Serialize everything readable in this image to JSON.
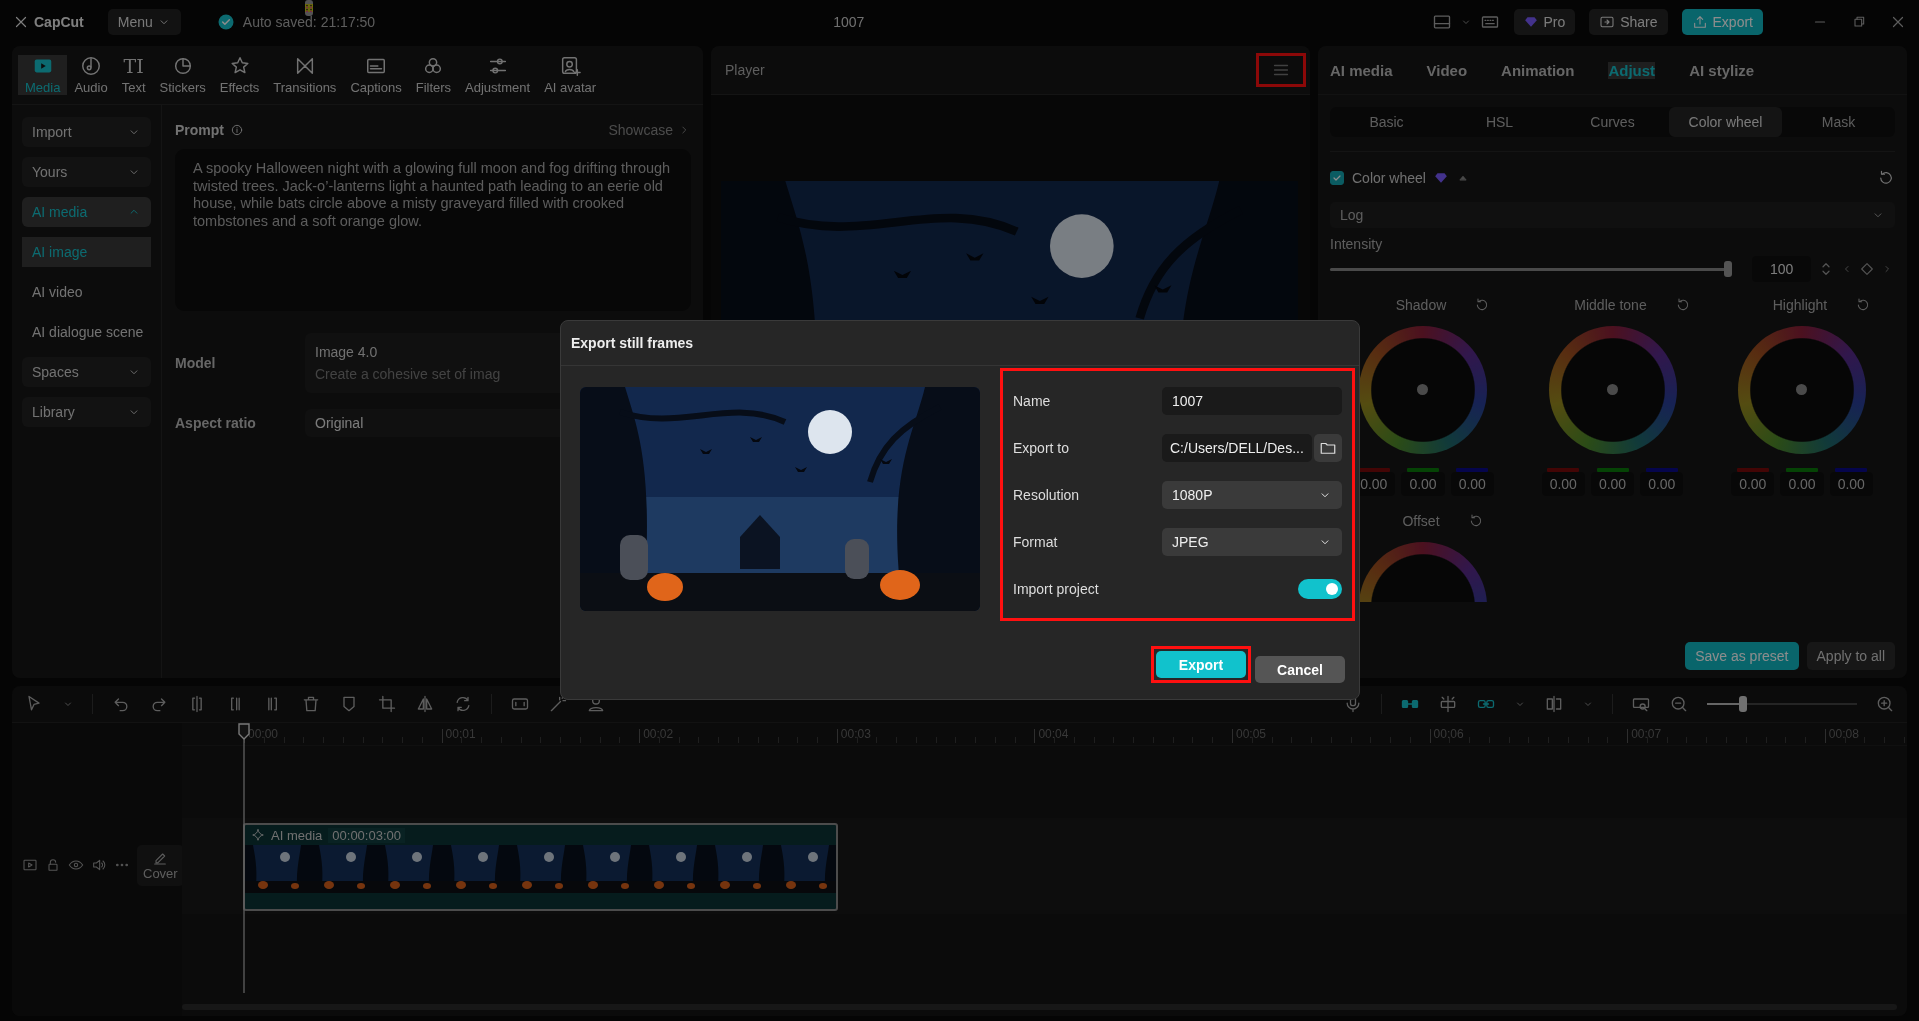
{
  "top_bar": {
    "logo": "CapCut",
    "menu": "Menu",
    "autosave": "Auto saved: 21:17:50",
    "title": "1007",
    "pro": "Pro",
    "share": "Share",
    "export": "Export"
  },
  "tool_tabs": [
    {
      "kind": "media",
      "label": "Media",
      "selected": true
    },
    {
      "kind": "audio",
      "label": "Audio",
      "selected": false
    },
    {
      "kind": "text",
      "glyph": "TI",
      "label": "Text",
      "selected": false
    },
    {
      "kind": "stickers",
      "label": "Stickers",
      "selected": false
    },
    {
      "kind": "effects",
      "label": "Effects",
      "selected": false
    },
    {
      "kind": "transitions",
      "label": "Transitions",
      "selected": false
    },
    {
      "kind": "captions",
      "label": "Captions",
      "selected": false
    },
    {
      "kind": "filters",
      "label": "Filters",
      "selected": false
    },
    {
      "kind": "adjustment",
      "label": "Adjustment",
      "selected": false
    },
    {
      "kind": "avatar",
      "label": "AI avatar",
      "selected": false
    }
  ],
  "sidebar": [
    {
      "kind": "group",
      "label": "Import",
      "expanded": false,
      "selected": false
    },
    {
      "kind": "group",
      "label": "Yours",
      "expanded": false,
      "selected": false
    },
    {
      "kind": "group",
      "label": "AI media",
      "expanded": true,
      "selected": true
    },
    {
      "kind": "item",
      "label": "AI image",
      "selected": true
    },
    {
      "kind": "item",
      "label": "AI video",
      "selected": false
    },
    {
      "kind": "item",
      "label": "AI dialogue scene",
      "selected": false
    },
    {
      "kind": "group",
      "label": "Spaces",
      "expanded": false,
      "selected": false
    },
    {
      "kind": "group",
      "label": "Library",
      "expanded": false,
      "selected": false
    }
  ],
  "prompt": {
    "label": "Prompt",
    "showcase": "Showcase",
    "text": "A spooky Halloween night with a glowing full moon and fog drifting through twisted trees. Jack-o’-lanterns light a haunted path leading to an eerie old house, while bats circle above a misty graveyard filled with crooked tombstones and a soft orange glow."
  },
  "model": {
    "label": "Model",
    "name": "Image 4.0",
    "description": "Create a cohesive set of imag"
  },
  "aspect_ratio": {
    "label": "Aspect ratio",
    "value": "Original"
  },
  "player": {
    "title": "Player",
    "menu_highlighted": true
  },
  "inspector": {
    "tabs": [
      {
        "label": "AI media",
        "selected": false
      },
      {
        "label": "Video",
        "selected": false
      },
      {
        "label": "Animation",
        "selected": false
      },
      {
        "label": "Adjust",
        "selected": true
      },
      {
        "label": "AI stylize",
        "selected": false
      }
    ],
    "subtabs": [
      {
        "label": "Basic",
        "selected": false
      },
      {
        "label": "HSL",
        "selected": false
      },
      {
        "label": "Curves",
        "selected": false
      },
      {
        "label": "Color wheel",
        "selected": true
      },
      {
        "label": "Mask",
        "selected": false
      }
    ],
    "color_wheel": {
      "label": "Color wheel",
      "checked": true,
      "expanded": true
    },
    "preset": "Log",
    "intensity": {
      "label": "Intensity",
      "level": 1,
      "value": "100"
    },
    "wheels": [
      {
        "label": "Shadow",
        "values": [
          "0.00",
          "0.00",
          "0.00"
        ]
      },
      {
        "label": "Middle tone",
        "values": [
          "0.00",
          "0.00",
          "0.00"
        ]
      },
      {
        "label": "Highlight",
        "values": [
          "0.00",
          "0.00",
          "0.00"
        ]
      }
    ],
    "offset": {
      "label": "Offset"
    },
    "save_preset": "Save as preset",
    "apply_all": "Apply to all"
  },
  "timeline": {
    "ruler": [
      "00:00",
      "00:01",
      "00:02",
      "00:03",
      "00:04",
      "00:05",
      "00:06",
      "00:07",
      "00:08"
    ],
    "zoom": {
      "level": 0.24
    },
    "cover": "Cover",
    "clip": {
      "label": "AI media",
      "duration": "00:00:03:00"
    }
  },
  "dialog": {
    "title": "Export still frames",
    "form_highlighted": true,
    "fields": [
      {
        "kind": "text",
        "label": "Name",
        "value": "1007"
      },
      {
        "kind": "path",
        "label": "Export to",
        "value": "C:/Users/DELL/Des..."
      },
      {
        "kind": "select",
        "label": "Resolution",
        "value": "1080P"
      },
      {
        "kind": "select",
        "label": "Format",
        "value": "JPEG"
      },
      {
        "kind": "toggle",
        "label": "Import project",
        "on": true
      }
    ],
    "buttons": [
      {
        "label": "Export",
        "primary": true,
        "highlighted": true
      },
      {
        "label": "Cancel",
        "primary": false,
        "highlighted": false
      }
    ]
  }
}
